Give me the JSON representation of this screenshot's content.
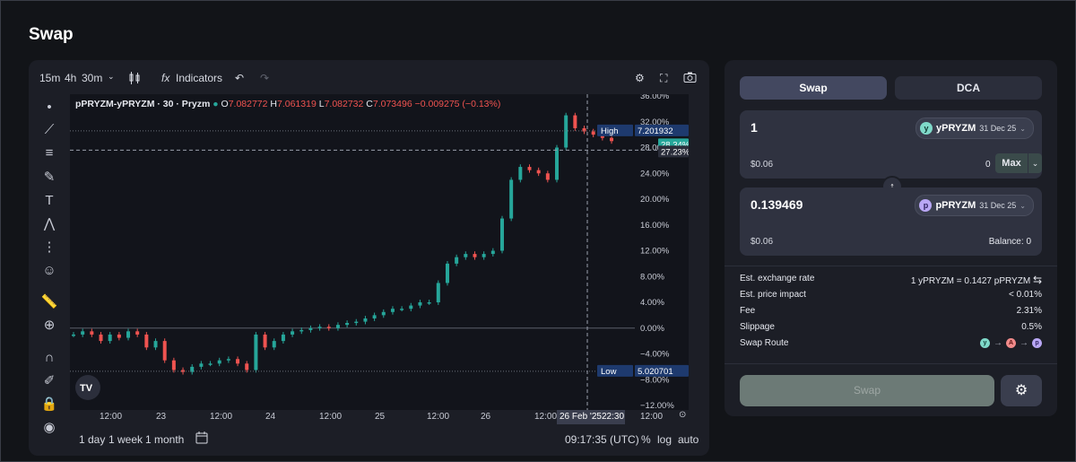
{
  "page": {
    "title": "Swap"
  },
  "chart": {
    "toolbar": {
      "intervals": [
        "15m",
        "4h",
        "30m"
      ],
      "indicators_label": "Indicators"
    },
    "legend": {
      "symbol": "pPRYZM-yPRYZM · 30 · Pryzm",
      "open_label": "O",
      "open": "7.082772",
      "high_label": "H",
      "high": "7.061319",
      "low_label": "L",
      "low": "7.082732",
      "close_label": "C",
      "close": "7.073496",
      "change": "−0.009275 (−0.13%)"
    },
    "high_tag": {
      "label": "High",
      "value": "7.201932"
    },
    "low_tag": {
      "label": "Low",
      "value": "5.020701"
    },
    "current_tag": "27.23%",
    "current_tag_green": "28.34%",
    "crosshair_date": "26 Feb '25",
    "crosshair_time": "22:30",
    "bottom": {
      "ranges": [
        "1 day",
        "1 week",
        "1 month"
      ],
      "clock": "09:17:35 (UTC)",
      "percent": "%",
      "log": "log",
      "auto": "auto"
    },
    "colors": {
      "up": "#26a69a",
      "down": "#ef5350",
      "tag": "#1e3a6e"
    }
  },
  "chart_data": {
    "type": "candlestick",
    "title": "pPRYZM-yPRYZM · 30 · Pryzm",
    "y_tick_labels": [
      "36.00%",
      "32.00%",
      "28.00%",
      "24.00%",
      "20.00%",
      "16.00%",
      "12.00%",
      "8.00%",
      "4.00%",
      "0.00%",
      "−4.00%",
      "−8.00%",
      "−12.00%"
    ],
    "x_tick_labels": [
      "12:00",
      "23",
      "12:00",
      "24",
      "12:00",
      "25",
      "12:00",
      "26",
      "12:00",
      "12:00"
    ],
    "ylim": [
      -12,
      36
    ],
    "percent_change_path": [
      -1,
      -0.5,
      -1,
      -2,
      -1,
      -1.5,
      -0.5,
      -1,
      -3,
      -2,
      -5,
      -6.5,
      -6.8,
      -6,
      -5.5,
      -5.5,
      -5,
      -4.8,
      -5.5,
      -6.5,
      -1,
      -3,
      -2,
      -1,
      -0.5,
      -0.3,
      0,
      0.2,
      0,
      0.5,
      0.8,
      1,
      1.5,
      2,
      2.5,
      3,
      3,
      3.5,
      4,
      4,
      7,
      10,
      11,
      11.5,
      11,
      11.5,
      12,
      17,
      23,
      25,
      24.5,
      24,
      23,
      28,
      33,
      31,
      30.5,
      30,
      29.5,
      29
    ],
    "high_label_value": 7.201932,
    "low_label_value": 5.020701,
    "annotations": [
      "High 7.201932",
      "Low 5.020701",
      "27.23%"
    ]
  },
  "swap": {
    "tabs": [
      "Swap",
      "DCA"
    ],
    "from": {
      "amount": "1",
      "token": "yPRYZM",
      "token_date": "31 Dec 25",
      "usd": "$0.06",
      "balance": "0",
      "max_label": "Max"
    },
    "to": {
      "amount": "0.139469",
      "token": "pPRYZM",
      "token_date": "31 Dec 25",
      "usd": "$0.06",
      "balance_label": "Balance:",
      "balance": "0"
    },
    "info": [
      {
        "label": "Est. exchange rate",
        "value": "1 yPRYZM = 0.1427 pPRYZM"
      },
      {
        "label": "Est. price impact",
        "value": "< 0.01%"
      },
      {
        "label": "Fee",
        "value": "2.31%"
      },
      {
        "label": "Slippage",
        "value": "0.5%"
      },
      {
        "label": "Swap Route",
        "value": ""
      }
    ],
    "swap_button": "Swap",
    "colors": {
      "y_token": "#7fd9c9",
      "p_token": "#b9a7f5"
    }
  }
}
